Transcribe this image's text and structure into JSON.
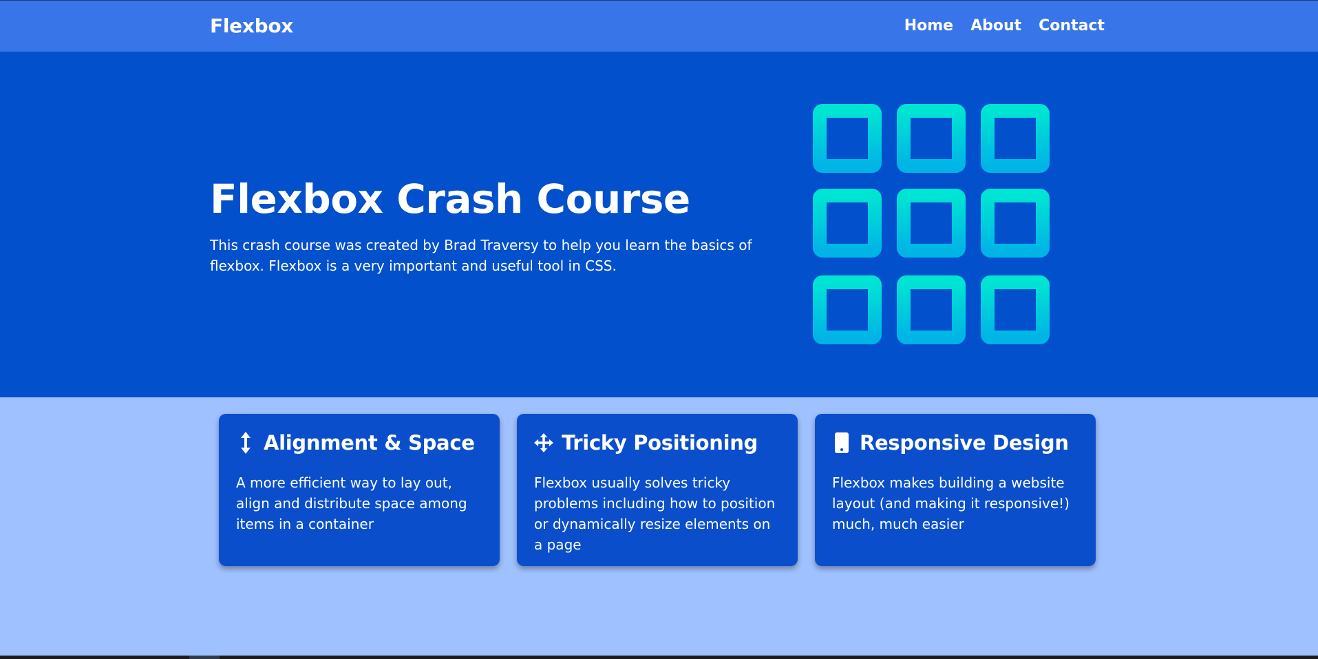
{
  "navbar": {
    "brand": "Flexbox",
    "links": [
      "Home",
      "About",
      "Contact"
    ]
  },
  "hero": {
    "title": "Flexbox Crash Course",
    "text": "This crash course was created by Brad Traversy to help you learn the basics of flexbox. Flexbox is a very important and useful tool in CSS.",
    "graphic_icon": "grid-3x3-icon"
  },
  "features": [
    {
      "icon": "arrows-vertical-icon",
      "title": "Alignment & Space",
      "text": "A more efficient way to lay out, align and distribute space among items in a container"
    },
    {
      "icon": "arrows-move-icon",
      "title": "Tricky Positioning",
      "text": "Flexbox usually solves tricky problems including how to position or dynamically resize elements on a page"
    },
    {
      "icon": "mobile-phone-icon",
      "title": "Responsive Design",
      "text": "Flexbox makes building a website layout (and making it responsive!) much, much easier"
    }
  ],
  "colors": {
    "navbar": "#3875e8",
    "hero": "#0250cb",
    "page": "#a0c1ff",
    "card": "#0a4ecb",
    "grid_gradient_top": "#00e5d3",
    "grid_gradient_bottom": "#00b4e6"
  }
}
